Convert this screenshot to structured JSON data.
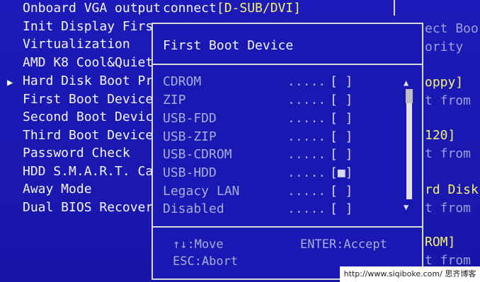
{
  "main_menu": {
    "items": [
      {
        "label": "Onboard VGA output"
      },
      {
        "label": "Init Display Firs"
      },
      {
        "label": "Virtualization"
      },
      {
        "label": "AMD K8 Cool&Quiet"
      },
      {
        "label": "Hard Disk Boot Pr"
      },
      {
        "label": "First Boot Device"
      },
      {
        "label": "Second Boot Devic"
      },
      {
        "label": "Third Boot Device"
      },
      {
        "label": "Password Check"
      },
      {
        "label": "HDD S.M.A.R.T. Ca"
      },
      {
        "label": "Away Mode"
      },
      {
        "label": "Dual BIOS Recover"
      }
    ],
    "first_value_prefix": "connect",
    "first_value_bracket": "[D-SUB/DVI]"
  },
  "right_fragments": [
    {
      "text": "ect Boo",
      "color": "gray"
    },
    {
      "text": "ority",
      "color": "gray"
    },
    {
      "text": "oppy]",
      "color": "yellow"
    },
    {
      "text": "t from",
      "color": "gray"
    },
    {
      "text": "120]",
      "color": "yellow"
    },
    {
      "text": "t from",
      "color": "gray"
    },
    {
      "text": "rd Disk",
      "color": "yellow"
    },
    {
      "text": "t from",
      "color": "gray"
    },
    {
      "text": "ROM]",
      "color": "yellow"
    },
    {
      "text": "t from",
      "color": "gray"
    }
  ],
  "popup": {
    "title": "First Boot Device",
    "options": [
      {
        "label": "CDROM",
        "dots": ".....",
        "box": "[ ]"
      },
      {
        "label": "ZIP",
        "dots": ".....",
        "box": "[ ]"
      },
      {
        "label": "USB-FDD",
        "dots": ".....",
        "box": "[ ]"
      },
      {
        "label": "USB-ZIP",
        "dots": ".....",
        "box": "[ ]"
      },
      {
        "label": "USB-CDROM",
        "dots": ".....",
        "box": "[ ]"
      },
      {
        "label": "USB-HDD",
        "dots": ".....",
        "box": "[■]"
      },
      {
        "label": "Legacy LAN",
        "dots": ".....",
        "box": "[ ]"
      },
      {
        "label": "Disabled",
        "dots": ".....",
        "box": "[ ]"
      }
    ],
    "scroll_up": "▲",
    "scroll_down": "▼",
    "help": {
      "move": "↑↓:Move",
      "accept": "ENTER:Accept",
      "abort": "ESC:Abort"
    }
  },
  "watermark": "http://www.siqiboke.com/  思齐博客",
  "colors": {
    "background": "#1a1ab0",
    "text": "#f4f4f4",
    "highlight": "#f6f36a",
    "dim": "#a8acd8"
  }
}
